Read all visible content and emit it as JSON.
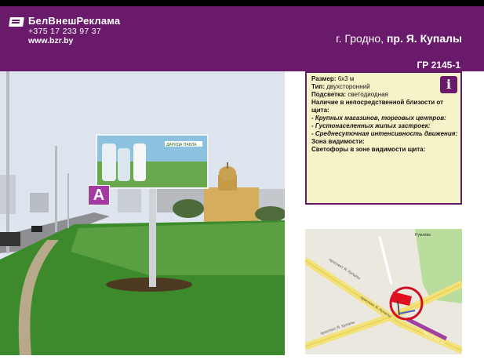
{
  "header": {
    "brand": "БелВнешРеклама",
    "phone": "+375 17 233 97 37",
    "site": "www.bzr.by",
    "location_prefix": "г. Гродно, ",
    "location_street": "пр. Я. Купалы",
    "code": "ГР 2145-1",
    "bg_color": "#6a1a6a"
  },
  "photo": {
    "side_label": "A",
    "billboard_brand": "ДАРИДА",
    "billboard_brand2": "ПАВЛА"
  },
  "info": {
    "size_label": "Размер:",
    "size_value": "6x3 м",
    "type_label": "Тип:",
    "type_value": "двухсторонний",
    "light_label": "Подсветка:",
    "light_value": "светодиодная",
    "near_label": "Наличие в непосредственной близости от щита:",
    "near_1": "- Крупных магазинов, торговых центров:",
    "near_2": "- Густонаселенных жилых застроек:",
    "near_3": "- Среднесуточная интенсивность движения:",
    "zone_label": "Зона видимости:",
    "lights_label": "Светофоры в зоне видимости щита:",
    "icon": "info-icon"
  },
  "map": {
    "road_1": "проспект Я. Купалы",
    "road_2": "проспект Я. Купалы",
    "road_3": "проспект Я. Купалы",
    "road_4": "Кахоўская ул.",
    "place": "Румлёво"
  }
}
